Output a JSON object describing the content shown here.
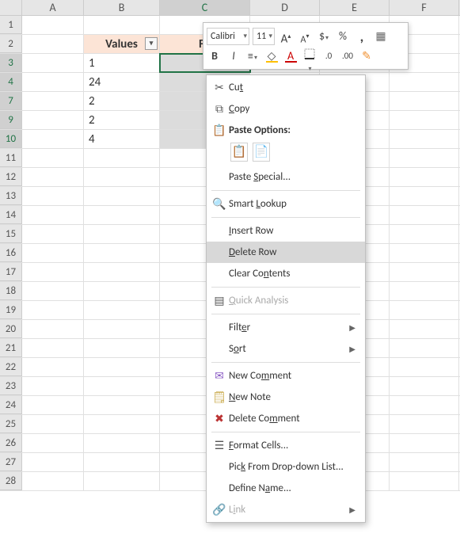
{
  "columns": [
    "A",
    "B",
    "C",
    "D",
    "E",
    "F"
  ],
  "visible_rows": [
    1,
    2,
    3,
    4,
    7,
    9,
    10,
    11,
    12,
    13,
    14,
    15,
    16,
    17,
    18,
    19,
    20,
    21,
    22,
    23,
    24,
    25,
    26,
    27,
    28
  ],
  "selected_row_headers": [
    3,
    4,
    7,
    9,
    10
  ],
  "header_row": {
    "b": "Values",
    "c_partial": "Fo"
  },
  "data_rows": {
    "3": "1",
    "4": "24",
    "7": "2",
    "9": "2",
    "10": "4"
  },
  "active_cell": "C3",
  "mini_toolbar": {
    "font_name": "Calibri",
    "font_size": "11",
    "increase_font": "A",
    "decrease_font": "A",
    "currency": "$",
    "percent": "%",
    "comma": ",",
    "bold": "B",
    "italic": "I",
    "fill_glyph": "◇",
    "font_color_glyph": "A",
    "decimal_inc": ".0",
    "decimal_dec": ".00",
    "brush": "✎"
  },
  "context_menu": {
    "cut": "Cut",
    "copy": "Copy",
    "paste_options": "Paste Options:",
    "paste_special": "Paste Special...",
    "smart_lookup": "Smart Lookup",
    "insert_row": "Insert Row",
    "delete_row": "Delete Row",
    "clear_contents": "Clear Contents",
    "quick_analysis": "Quick Analysis",
    "filter": "Filter",
    "sort": "Sort",
    "new_comment": "New Comment",
    "new_note": "New Note",
    "delete_comment": "Delete Comment",
    "format_cells": "Format Cells...",
    "pick_list": "Pick From Drop-down List...",
    "define_name": "Define Name...",
    "link": "Link"
  }
}
